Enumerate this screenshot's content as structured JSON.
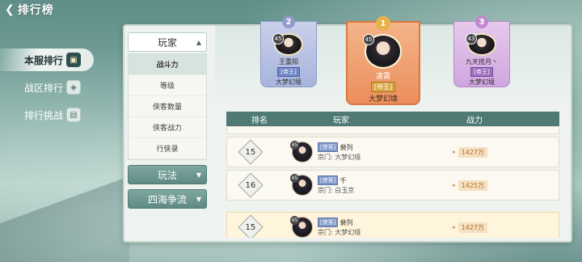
{
  "header": {
    "back_icon": "back-arrow-icon",
    "title": "排行榜"
  },
  "left_tabs": [
    {
      "label": "本服排行",
      "icon": "server-icon",
      "active": true
    },
    {
      "label": "战区排行",
      "icon": "region-icon",
      "active": false
    },
    {
      "label": "排行挑战",
      "icon": "challenge-icon",
      "active": false
    }
  ],
  "categories": {
    "player": {
      "label": "玩家",
      "expanded": true
    },
    "sub_items": [
      "战斗力",
      "等级",
      "侠客数量",
      "侠客战力",
      "行侠录"
    ],
    "active_sub": "战斗力",
    "gameplay": {
      "label": "玩法"
    },
    "world": {
      "label": "四海争流"
    }
  },
  "podium": {
    "first": {
      "rank": "1",
      "level": "45",
      "name": "凌霄",
      "title": "[帝王]",
      "sect": "大梦幻境"
    },
    "second": {
      "rank": "2",
      "level": "45",
      "name": "王重阳",
      "title": "[帝王]",
      "sect": "大梦幻境"
    },
    "third": {
      "rank": "3",
      "level": "43",
      "name": "九天揽月丶",
      "title": "[帝王]",
      "sect": "大梦幻境"
    }
  },
  "table": {
    "headers": {
      "rank": "排名",
      "player": "玩家",
      "power": "战力"
    },
    "rows": [
      {
        "rank": "15",
        "level": "45",
        "tag": "[侠客]",
        "name": "裴列",
        "sect": "宗门: 大梦幻境",
        "power": "1427万",
        "mine": false
      },
      {
        "rank": "16",
        "level": "45",
        "tag": "[侠客]",
        "name": "千",
        "sect": "宗门: 白玉京",
        "power": "1425万",
        "mine": false
      },
      {
        "rank": "15",
        "level": "45",
        "tag": "[侠客]",
        "name": "裴列",
        "sect": "宗门: 大梦幻境",
        "power": "1427万",
        "mine": true
      }
    ]
  },
  "colors": {
    "accent": "#4f7a74",
    "first_place": "#eb8f5c",
    "second_place": "#a7b4dd",
    "third_place": "#cfa6df"
  }
}
